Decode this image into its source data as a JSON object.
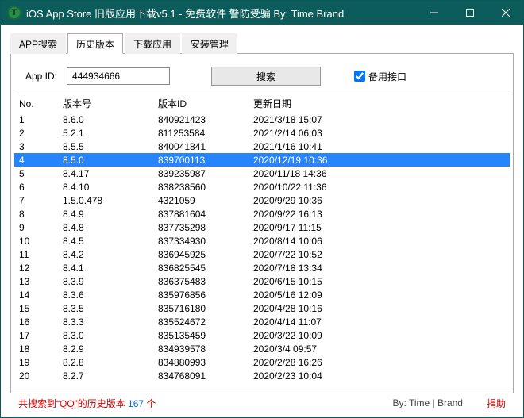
{
  "window": {
    "title": "iOS App Store 旧版应用下载v5.1 - 免费软件 警防受骗 By: Time Brand"
  },
  "tabs": {
    "items": [
      {
        "label": "APP搜索"
      },
      {
        "label": "历史版本"
      },
      {
        "label": "下载应用"
      },
      {
        "label": "安装管理"
      }
    ]
  },
  "search": {
    "appid_label": "App ID:",
    "appid_value": "444934666",
    "button_label": "搜索",
    "backup_label": "备用接口"
  },
  "table": {
    "headers": {
      "no": "No.",
      "version": "版本号",
      "vid": "版本ID",
      "date": "更新日期"
    },
    "rows": [
      {
        "no": "1",
        "version": "8.6.0",
        "vid": "840921423",
        "date": "2021/3/18 15:07",
        "selected": false
      },
      {
        "no": "2",
        "version": "5.2.1",
        "vid": "811253584",
        "date": "2021/2/14 06:03",
        "selected": false
      },
      {
        "no": "3",
        "version": "8.5.5",
        "vid": "840041841",
        "date": "2021/1/16 10:41",
        "selected": false
      },
      {
        "no": "4",
        "version": "8.5.0",
        "vid": "839700113",
        "date": "2020/12/19 10:36",
        "selected": true
      },
      {
        "no": "5",
        "version": "8.4.17",
        "vid": "839235987",
        "date": "2020/11/18 14:36",
        "selected": false
      },
      {
        "no": "6",
        "version": "8.4.10",
        "vid": "838238560",
        "date": "2020/10/22 11:36",
        "selected": false
      },
      {
        "no": "7",
        "version": "1.5.0.478",
        "vid": "4321059",
        "date": "2020/9/29 10:36",
        "selected": false
      },
      {
        "no": "8",
        "version": "8.4.9",
        "vid": "837881604",
        "date": "2020/9/22 16:13",
        "selected": false
      },
      {
        "no": "9",
        "version": "8.4.8",
        "vid": "837735298",
        "date": "2020/9/17 11:15",
        "selected": false
      },
      {
        "no": "10",
        "version": "8.4.5",
        "vid": "837334930",
        "date": "2020/8/14 10:06",
        "selected": false
      },
      {
        "no": "11",
        "version": "8.4.2",
        "vid": "836945925",
        "date": "2020/7/22 10:52",
        "selected": false
      },
      {
        "no": "12",
        "version": "8.4.1",
        "vid": "836825545",
        "date": "2020/7/18 13:34",
        "selected": false
      },
      {
        "no": "13",
        "version": "8.3.9",
        "vid": "836375483",
        "date": "2020/6/15 10:15",
        "selected": false
      },
      {
        "no": "14",
        "version": "8.3.6",
        "vid": "835976856",
        "date": "2020/5/16 12:09",
        "selected": false
      },
      {
        "no": "15",
        "version": "8.3.5",
        "vid": "835716180",
        "date": "2020/4/28 10:16",
        "selected": false
      },
      {
        "no": "16",
        "version": "8.3.3",
        "vid": "835524672",
        "date": "2020/4/14 11:07",
        "selected": false
      },
      {
        "no": "17",
        "version": "8.3.0",
        "vid": "835135459",
        "date": "2020/3/22 10:09",
        "selected": false
      },
      {
        "no": "18",
        "version": "8.2.9",
        "vid": "834939578",
        "date": "2020/3/4 09:57",
        "selected": false
      },
      {
        "no": "19",
        "version": "8.2.8",
        "vid": "834880993",
        "date": "2020/2/28 16:26",
        "selected": false
      },
      {
        "no": "20",
        "version": "8.2.7",
        "vid": "834768091",
        "date": "2020/2/23 10:04",
        "selected": false
      }
    ]
  },
  "status": {
    "prefix": "共搜索到",
    "quote_open": "“",
    "app_name": "QQ",
    "quote_close": "”",
    "suffix": "的历史版本",
    "count": "167",
    "unit": "个",
    "credit": "By: Time | Brand",
    "donate": "捐助"
  }
}
